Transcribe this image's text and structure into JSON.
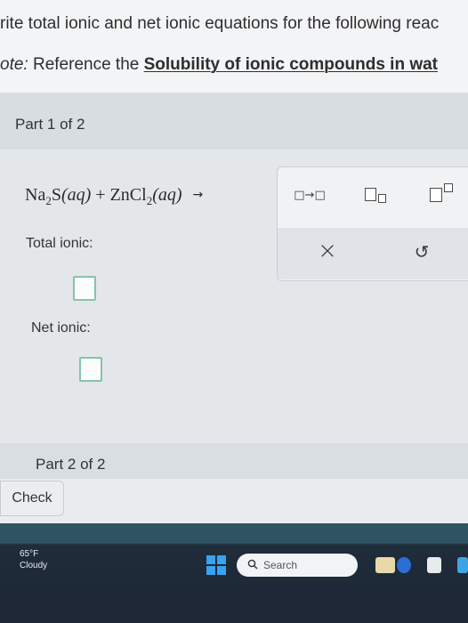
{
  "instructions": {
    "line1": "rite total ionic and net ionic equations for the following reac",
    "note_label": "ote:",
    "note_text": " Reference the ",
    "note_bold": "Solubility of ionic compounds in wat"
  },
  "part1": {
    "title": "Part 1 of 2",
    "equation": {
      "r1_formula": "Na",
      "r1_sub": "2",
      "r1_rest": "S",
      "r1_state": "(aq)",
      "plus": " + ",
      "r2_formula": "ZnCl",
      "r2_sub": "2",
      "r2_state": "(aq)",
      "arrow": "→"
    },
    "total_ionic_label": "Total ionic:",
    "net_ionic_label": "Net ionic:"
  },
  "palette": {
    "arrow_tool": "□→□",
    "clear_icon": "×",
    "undo_icon": "↺"
  },
  "part2": {
    "title": "Part 2 of 2"
  },
  "check_button": "Check",
  "taskbar": {
    "temperature": "65°F",
    "weather": "Cloudy",
    "search_placeholder": "Search"
  }
}
